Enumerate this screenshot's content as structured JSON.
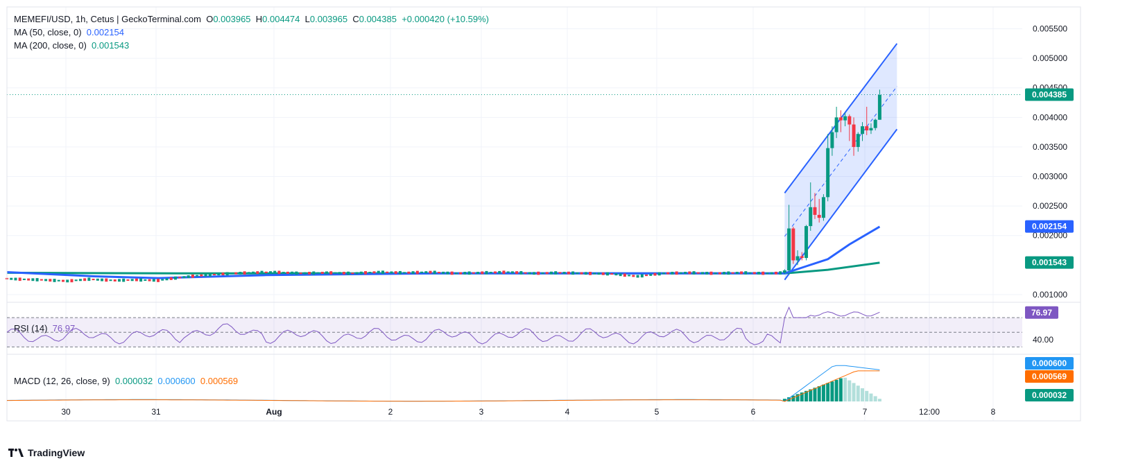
{
  "header": {
    "symbol_line": "MEMEFI/USD, 1h, Cetus | GeckoTerminal.com",
    "o_label": "O",
    "o_value": "0.003965",
    "h_label": "H",
    "h_value": "0.004474",
    "l_label": "L",
    "l_value": "0.003965",
    "c_label": "C",
    "c_value": "0.004385",
    "change": "+0.000420 (+10.59%)"
  },
  "ma50": {
    "label": "MA (50, close, 0)",
    "value": "0.002154"
  },
  "ma200": {
    "label": "MA (200, close, 0)",
    "value": "0.001543"
  },
  "rsi": {
    "label": "RSI (14)",
    "value": "76.97",
    "level_label": "40.00"
  },
  "macd": {
    "label": "MACD (12, 26, close, 9)",
    "hist": "0.000032",
    "macd": "0.000600",
    "signal": "0.000569"
  },
  "brand": "TradingView",
  "colors": {
    "up": "#089981",
    "down": "#f23645",
    "ma50": "#2962ff",
    "ma200": "#089981",
    "channel": "#2962ff",
    "rsi": "#7e57c2",
    "macd": "#2196f3",
    "signal": "#ff6d00"
  },
  "chart_data": {
    "type": "candlestick",
    "title": "MEMEFI/USD, 1h, Cetus | GeckoTerminal.com",
    "x_ticks": [
      "30",
      "31",
      "Aug",
      "2",
      "3",
      "4",
      "5",
      "6",
      "7",
      "12:00",
      "8"
    ],
    "y_ticks": [
      "0.005500",
      "0.005000",
      "0.004500",
      "0.004000",
      "0.003500",
      "0.003000",
      "0.002500",
      "0.002000",
      "0.001000"
    ],
    "ylim": [
      0.00087,
      0.00587
    ],
    "last_price": "0.004385",
    "price_series": [
      [
        0.0,
        0.00127
      ],
      [
        3.0,
        0.00126
      ],
      [
        8.0,
        0.00125
      ],
      [
        14.0,
        0.00123
      ],
      [
        19.0,
        0.00126
      ],
      [
        25.0,
        0.00124
      ],
      [
        30.0,
        0.00125
      ],
      [
        35.0,
        0.00124
      ],
      [
        39.0,
        0.00128
      ],
      [
        44.0,
        0.00132
      ],
      [
        50.0,
        0.00135
      ],
      [
        56.0,
        0.00137
      ],
      [
        62.0,
        0.00138
      ],
      [
        68.0,
        0.00136
      ],
      [
        74.0,
        0.00137
      ],
      [
        80.0,
        0.00136
      ],
      [
        86.0,
        0.00138
      ],
      [
        92.0,
        0.00137
      ],
      [
        98.0,
        0.00138
      ],
      [
        104.0,
        0.00136
      ],
      [
        110.0,
        0.00137
      ],
      [
        116.0,
        0.00138
      ],
      [
        122.0,
        0.00136
      ],
      [
        128.0,
        0.00137
      ],
      [
        134.0,
        0.00136
      ],
      [
        140.0,
        0.00135
      ],
      [
        146.0,
        0.00131
      ],
      [
        152.0,
        0.00136
      ],
      [
        158.0,
        0.00137
      ],
      [
        164.0,
        0.00136
      ],
      [
        170.0,
        0.00137
      ],
      [
        176.0,
        0.00136
      ],
      [
        180.0,
        0.00137
      ]
    ],
    "spike_candles": [
      {
        "x": 180.0,
        "o": 0.00137,
        "h": 0.00143,
        "l": 0.00135,
        "c": 0.00141
      },
      {
        "x": 181.0,
        "o": 0.00141,
        "h": 0.00252,
        "l": 0.00138,
        "c": 0.00212
      },
      {
        "x": 182.0,
        "o": 0.00212,
        "h": 0.00215,
        "l": 0.00152,
        "c": 0.00158
      },
      {
        "x": 183.0,
        "o": 0.00158,
        "h": 0.00175,
        "l": 0.0015,
        "c": 0.00165
      },
      {
        "x": 184.0,
        "o": 0.00165,
        "h": 0.00172,
        "l": 0.00158,
        "c": 0.00162
      },
      {
        "x": 185.0,
        "o": 0.00162,
        "h": 0.00218,
        "l": 0.00158,
        "c": 0.00216
      },
      {
        "x": 186.0,
        "o": 0.00216,
        "h": 0.0029,
        "l": 0.00208,
        "c": 0.00248
      },
      {
        "x": 187.0,
        "o": 0.00248,
        "h": 0.00272,
        "l": 0.00228,
        "c": 0.00235
      },
      {
        "x": 188.0,
        "o": 0.00235,
        "h": 0.00262,
        "l": 0.00222,
        "c": 0.0023
      },
      {
        "x": 189.0,
        "o": 0.0023,
        "h": 0.0027,
        "l": 0.00225,
        "c": 0.00265
      },
      {
        "x": 190.0,
        "o": 0.00265,
        "h": 0.00372,
        "l": 0.00258,
        "c": 0.00348
      },
      {
        "x": 191.0,
        "o": 0.00348,
        "h": 0.00385,
        "l": 0.00335,
        "c": 0.00375
      },
      {
        "x": 192.0,
        "o": 0.00375,
        "h": 0.00418,
        "l": 0.00365,
        "c": 0.004
      },
      {
        "x": 193.0,
        "o": 0.004,
        "h": 0.00412,
        "l": 0.00375,
        "c": 0.00395
      },
      {
        "x": 194.0,
        "o": 0.00395,
        "h": 0.00408,
        "l": 0.00385,
        "c": 0.00402
      },
      {
        "x": 195.0,
        "o": 0.00402,
        "h": 0.00405,
        "l": 0.0036,
        "c": 0.00388
      },
      {
        "x": 196.0,
        "o": 0.00388,
        "h": 0.004,
        "l": 0.00335,
        "c": 0.0035
      },
      {
        "x": 197.0,
        "o": 0.0035,
        "h": 0.00375,
        "l": 0.00342,
        "c": 0.00372
      },
      {
        "x": 198.0,
        "o": 0.00372,
        "h": 0.00392,
        "l": 0.0036,
        "c": 0.00385
      },
      {
        "x": 199.0,
        "o": 0.00385,
        "h": 0.00418,
        "l": 0.0037,
        "c": 0.00378
      },
      {
        "x": 200.0,
        "o": 0.00378,
        "h": 0.0039,
        "l": 0.00372,
        "c": 0.00382
      },
      {
        "x": 201.0,
        "o": 0.00382,
        "h": 0.00398,
        "l": 0.00378,
        "c": 0.00396
      },
      {
        "x": 202.0,
        "o": 0.00396,
        "h": 0.00447,
        "l": 0.00396,
        "c": 0.00438
      }
    ],
    "ma50_series": [
      [
        0,
        0.00138
      ],
      [
        20,
        0.00131
      ],
      [
        35,
        0.00128
      ],
      [
        60,
        0.00133
      ],
      [
        100,
        0.00136
      ],
      [
        150,
        0.00136
      ],
      [
        180,
        0.00136
      ],
      [
        185,
        0.00148
      ],
      [
        190,
        0.0016
      ],
      [
        195,
        0.00185
      ],
      [
        202,
        0.00215
      ]
    ],
    "ma200_series": [
      [
        0,
        0.00137
      ],
      [
        40,
        0.00136
      ],
      [
        100,
        0.00136
      ],
      [
        180,
        0.00136
      ],
      [
        190,
        0.00142
      ],
      [
        202,
        0.00154
      ]
    ],
    "channel": {
      "x0": 180,
      "x1": 206,
      "upper": [
        0.00272,
        0.00525
      ],
      "lower": [
        0.00125,
        0.0038
      ]
    },
    "rsi_levels": [
      70,
      50,
      30
    ],
    "rsi_ylim": [
      20,
      90
    ],
    "macd_hist_start": 180
  }
}
